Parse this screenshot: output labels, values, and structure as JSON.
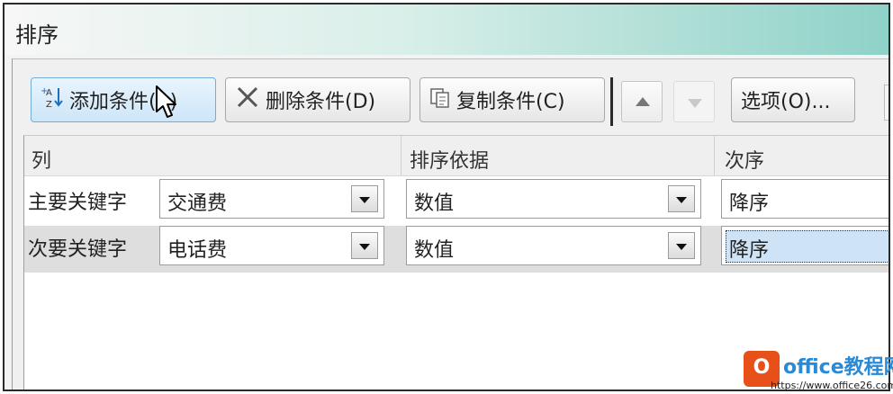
{
  "dialog": {
    "title": "排序"
  },
  "toolbar": {
    "add_label": "添加条件(A)",
    "delete_label": "删除条件(D)",
    "copy_label": "复制条件(C)",
    "options_label": "选项(O)..."
  },
  "columns": {
    "col": "列",
    "sort_on": "排序依据",
    "order": "次序"
  },
  "rows": [
    {
      "label": "主要关键字",
      "column": "交通费",
      "sort_on": "数值",
      "order": "降序"
    },
    {
      "label": "次要关键字",
      "column": "电话费",
      "sort_on": "数值",
      "order": "降序"
    }
  ],
  "watermark": {
    "logo": "O",
    "title": "office教程网",
    "url": "https://www.office26.com"
  },
  "colors": {
    "accent": "#73acd8",
    "selection": "#cfe3f6"
  }
}
